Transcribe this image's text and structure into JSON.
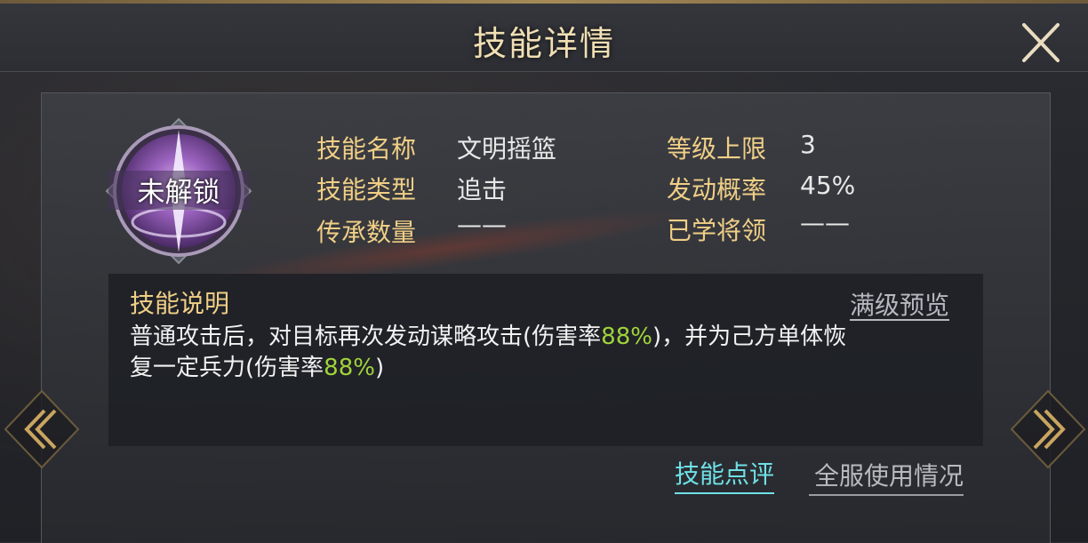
{
  "header": {
    "title": "技能详情"
  },
  "skill": {
    "status_label": "未解锁",
    "fields": [
      {
        "label": "技能名称",
        "value": "文明摇篮"
      },
      {
        "label": "技能类型",
        "value": "追击"
      },
      {
        "label": "传承数量",
        "value": "——"
      },
      {
        "label": "等级上限",
        "value": "3"
      },
      {
        "label": "发动概率",
        "value": "45%"
      },
      {
        "label": "已学将领",
        "value": "——"
      }
    ]
  },
  "description": {
    "title": "技能说明",
    "preview_link": "满级预览",
    "line1_part1": "普通攻击后，对目标再次发动谋略攻击(伤害率",
    "line1_highlight": "88%",
    "line1_part2": ")，并为己方单体恢",
    "line2_part1": "复一定兵力(伤害率",
    "line2_highlight": "88%",
    "line2_part2": ")",
    "highlight_color": "#9fd33b"
  },
  "footer": {
    "review_link": "技能点评",
    "usage_link": "全服使用情况"
  },
  "icons": {
    "close": "close-icon",
    "prev": "chevron-left-double-icon",
    "next": "chevron-right-double-icon",
    "skill": "skill-emblem-icon"
  }
}
